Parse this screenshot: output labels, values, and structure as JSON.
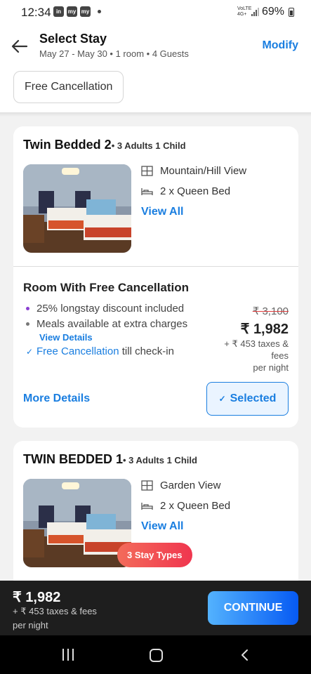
{
  "status_bar": {
    "time": "12:34",
    "app_icons": [
      "in",
      "my",
      "my"
    ],
    "network": "VoLTE 4G+",
    "battery": "69%"
  },
  "header": {
    "title": "Select Stay",
    "subtitle": "May 27 - May 30 • 1 room • 4 Guests",
    "modify_label": "Modify",
    "filter_chip": "Free Cancellation"
  },
  "rooms": [
    {
      "name": "Twin Bedded 2",
      "occupancy": "• 3 Adults 1 Child",
      "features": [
        {
          "icon": "view-icon",
          "label": "Mountain/Hill View"
        },
        {
          "icon": "bed-icon",
          "label": "2 x Queen Bed"
        }
      ],
      "view_all_label": "View All",
      "rate_plan": {
        "title": "Room With Free Cancellation",
        "inclusions": [
          {
            "text": "25% longstay discount included"
          },
          {
            "text": "Meals available at extra charges"
          },
          {
            "text_highlight": "Free Cancellation",
            "text_rest": " till check-in"
          }
        ],
        "view_details_label": "View Details",
        "original_price": "₹ 3,100",
        "price": "₹ 1,982",
        "taxes": "+ ₹ 453 taxes & fees",
        "per_night": "per night",
        "more_details_label": "More Details",
        "selected_label": "Selected"
      }
    },
    {
      "name": "TWIN BEDDED 1",
      "occupancy": "• 3 Adults 1 Child",
      "features": [
        {
          "icon": "view-icon",
          "label": "Garden View"
        },
        {
          "icon": "bed-icon",
          "label": "2 x Queen Bed"
        }
      ],
      "view_all_label": "View All",
      "stay_types_label": "3 Stay Types"
    }
  ],
  "footer": {
    "price": "₹ 1,982",
    "taxes": "+ ₹ 453 taxes & fees",
    "per_night": "per night",
    "continue_label": "CONTINUE"
  },
  "colors": {
    "accent": "#1a7ee0",
    "selected_bg": "#eaf4ff",
    "stay_types_badge": "#f0364f",
    "footer_bg": "#1e1e1e",
    "strike_line": "#e03c3c"
  }
}
